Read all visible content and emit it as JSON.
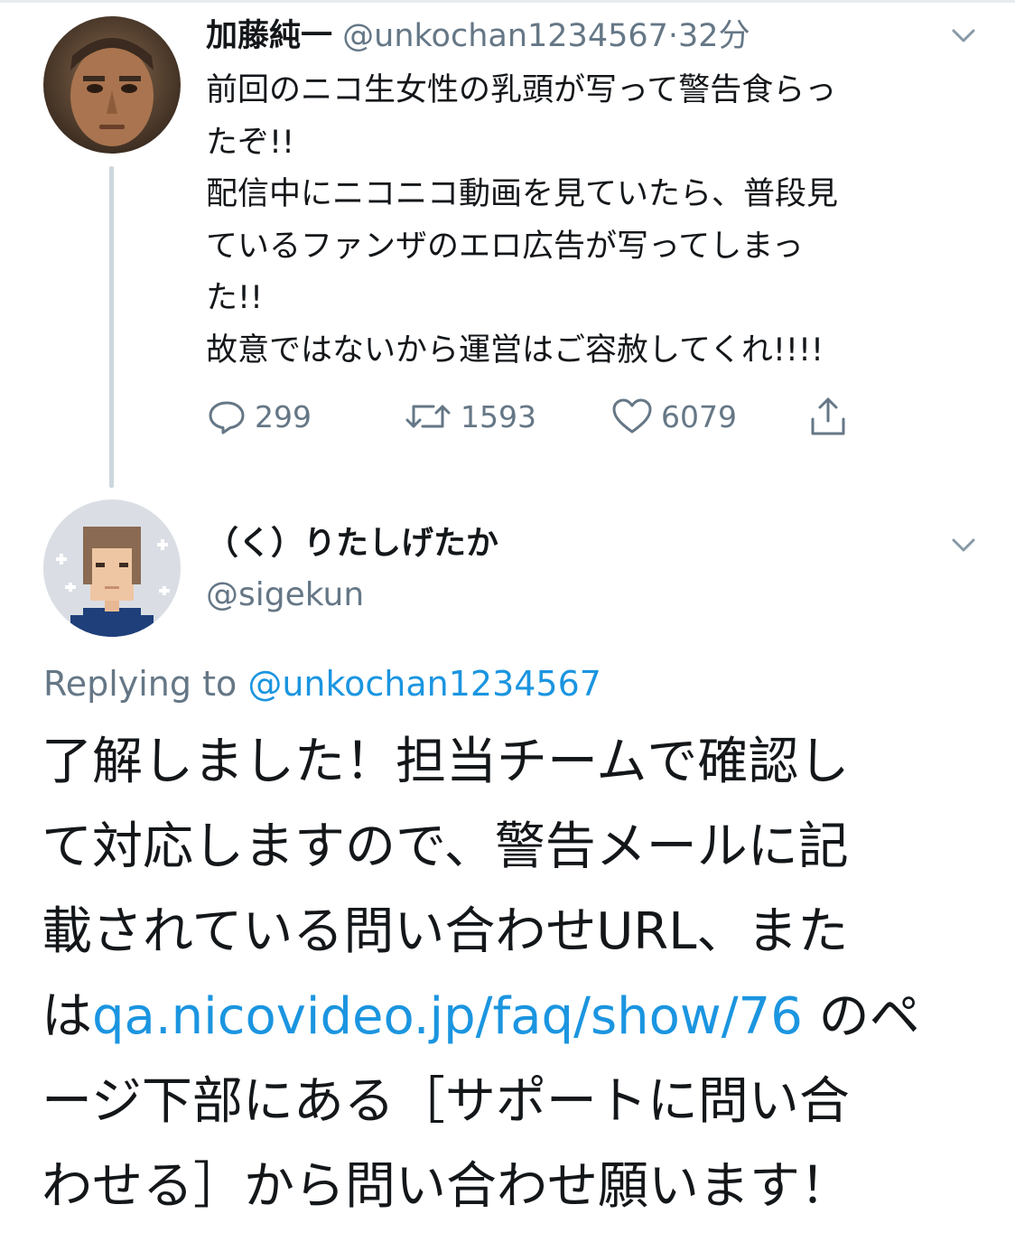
{
  "tweet": {
    "display_name": "加藤純一",
    "handle": "@unkochan1234567",
    "dot": "·",
    "time": "32分",
    "text_lines": [
      "前回のニコ生女性の乳頭が写って警告食らっ",
      "たぞ!!",
      "配信中にニコニコ動画を見ていたら、普段見",
      "ているファンザのエロ広告が写ってしまっ",
      "た!!",
      "故意ではないから運営はご容赦してくれ!!!!"
    ],
    "actions": {
      "replies": "299",
      "retweets": "1593",
      "likes": "6079"
    },
    "icons": {
      "reply": "speech-bubble-icon",
      "retweet": "retweet-arrows-icon",
      "like": "heart-icon",
      "share": "share-upload-icon",
      "menu": "chevron-down-icon"
    }
  },
  "reply": {
    "display_name": "（く）りたしげたか",
    "handle": "@sigekun",
    "replying_prefix": "Replying to ",
    "replying_handle": "@unkochan1234567",
    "line1": "了解しました！担当チームで確認し",
    "line2": "て対応しますので、警告メールに記",
    "line3": "載されている問い合わせURL、また",
    "line4_prefix": "は",
    "link": "qa.nicovideo.jp/faq/show/76",
    "line4_suffix": " のペ",
    "line5": "ージ下部にある［サポートに問い合",
    "line6": "わせる］から問い合わせ願います！"
  },
  "colors": {
    "link": "#1b95e0",
    "muted": "#657786",
    "text": "#14171a",
    "thread_line": "#ccd6dd"
  }
}
